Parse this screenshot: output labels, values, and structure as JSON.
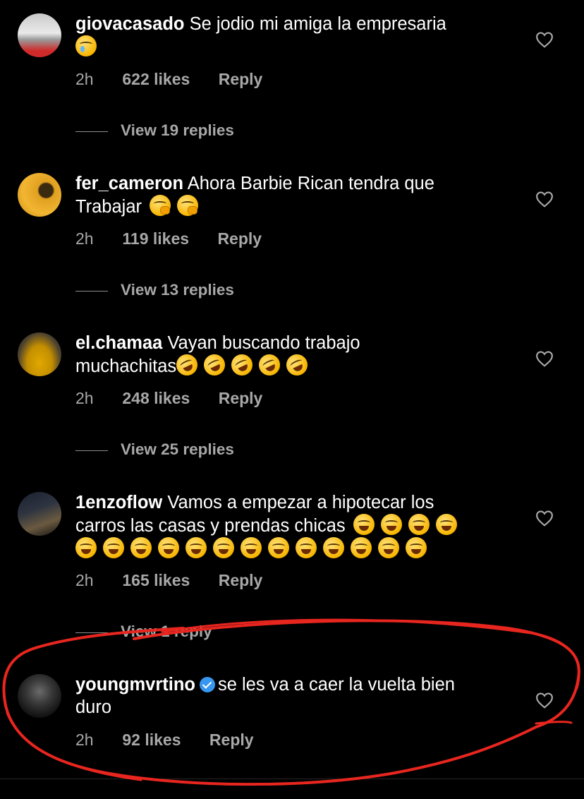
{
  "comments": [
    {
      "username": "giovacasado",
      "text": "Se jodio mi amiga la empresaria",
      "time": "2h",
      "likes": "622 likes",
      "reply": "Reply",
      "view_replies": "View 19 replies",
      "emojis": [
        "cry"
      ]
    },
    {
      "username": "fer_cameron",
      "text": "Ahora Barbie Rican tendra que",
      "text2": "Trabajar",
      "time": "2h",
      "likes": "119 likes",
      "reply": "Reply",
      "view_replies": "View 13 replies",
      "emojis": [
        "hush",
        "hush"
      ]
    },
    {
      "username": "el.chamaa",
      "text": "Vayan buscando trabajo",
      "text2": "muchachitas",
      "time": "2h",
      "likes": "248 likes",
      "reply": "Reply",
      "view_replies": "View 25 replies",
      "emojis": [
        "rofl",
        "rofl",
        "rofl",
        "rofl",
        "rofl"
      ]
    },
    {
      "username": "1enzoflow",
      "text": "Vamos a empezar a hipotecar los",
      "text2": "carros las casas y prendas chicas",
      "time": "2h",
      "likes": "165 likes",
      "reply": "Reply",
      "view_replies": "View 1 reply",
      "emojis": [
        "laugh",
        "laugh",
        "laugh",
        "laugh"
      ],
      "emojis2": [
        "laugh",
        "laugh",
        "laugh",
        "laugh",
        "laugh",
        "laugh",
        "laugh",
        "laugh",
        "laugh",
        "laugh",
        "laugh",
        "laugh",
        "laugh"
      ]
    },
    {
      "username": "youngmvrtino",
      "verified": true,
      "text": "se les va a caer la vuelta bien",
      "text2": "duro",
      "time": "2h",
      "likes": "92 likes",
      "reply": "Reply"
    }
  ],
  "icons": {
    "like": "heart-outline-icon",
    "verified": "verified-badge-icon"
  },
  "colors": {
    "background": "#000000",
    "secondary_text": "#a8a8a8",
    "verified": "#3797f0",
    "annotation": "#e8261f"
  }
}
